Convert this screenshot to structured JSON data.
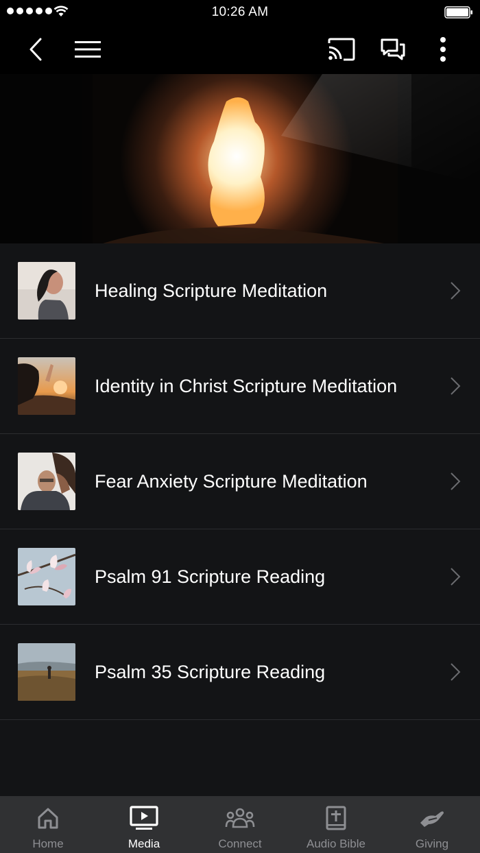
{
  "status_bar": {
    "time": "10:26 AM"
  },
  "nav": {
    "back": "back-icon",
    "menu": "menu-icon",
    "cast": "cast-icon",
    "chat": "chat-icon",
    "more": "more-icon"
  },
  "hero": {
    "image": "cave-light-image"
  },
  "items": [
    {
      "title": "Healing Scripture Meditation",
      "thumb": "woman-praying-thumbnail"
    },
    {
      "title": "Identity in Christ Scripture Meditation",
      "thumb": "sunset-hand-thumbnail"
    },
    {
      "title": "Fear Anxiety Scripture Meditation",
      "thumb": "couple-embrace-thumbnail"
    },
    {
      "title": "Psalm 91 Scripture Reading",
      "thumb": "magnolia-thumbnail"
    },
    {
      "title": "Psalm 35 Scripture Reading",
      "thumb": "field-walker-thumbnail"
    }
  ],
  "tabs": [
    {
      "label": "Home",
      "icon": "home-icon",
      "active": false
    },
    {
      "label": "Media",
      "icon": "media-icon",
      "active": true
    },
    {
      "label": "Connect",
      "icon": "people-icon",
      "active": false
    },
    {
      "label": "Audio Bible",
      "icon": "bible-icon",
      "active": false
    },
    {
      "label": "Giving",
      "icon": "giving-hand-icon",
      "active": false
    }
  ],
  "colors": {
    "background": "#131416",
    "tab_bar": "#303133",
    "inactive": "#8e8f93",
    "active": "#ffffff"
  }
}
